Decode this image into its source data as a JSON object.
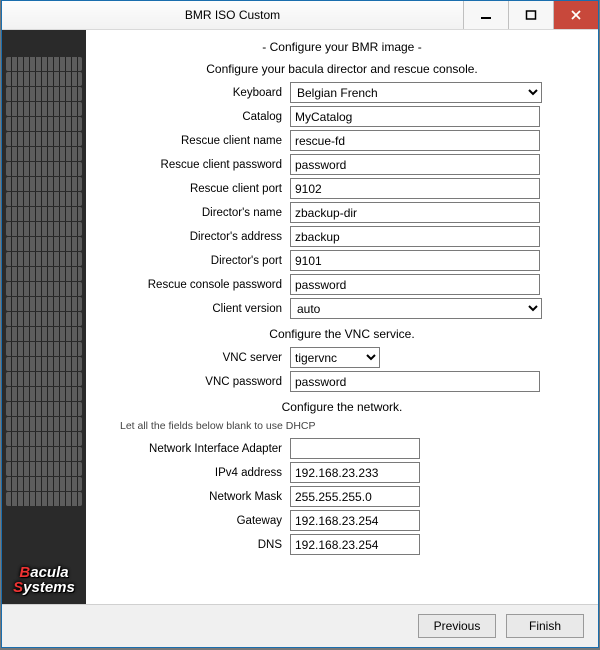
{
  "window": {
    "title": "BMR ISO Custom"
  },
  "headings": {
    "main": "- Configure your BMR image -",
    "section_director": "Configure your bacula director and rescue console.",
    "section_vnc": "Configure the VNC service.",
    "section_network": "Configure the network.",
    "network_hint": "Let all the fields below blank to use DHCP"
  },
  "labels": {
    "keyboard": "Keyboard",
    "catalog": "Catalog",
    "rescue_client_name": "Rescue client name",
    "rescue_client_password": "Rescue client password",
    "rescue_client_port": "Rescue client port",
    "director_name": "Director's name",
    "director_address": "Director's address",
    "director_port": "Director's port",
    "rescue_console_password": "Rescue console password",
    "client_version": "Client version",
    "vnc_server": "VNC server",
    "vnc_password": "VNC password",
    "nic": "Network Interface Adapter",
    "ipv4": "IPv4 address",
    "netmask": "Network Mask",
    "gateway": "Gateway",
    "dns": "DNS"
  },
  "values": {
    "keyboard": "Belgian French",
    "catalog": "MyCatalog",
    "rescue_client_name": "rescue-fd",
    "rescue_client_password": "password",
    "rescue_client_port": "9102",
    "director_name": "zbackup-dir",
    "director_address": "zbackup",
    "director_port": "9101",
    "rescue_console_password": "password",
    "client_version": "auto",
    "vnc_server": "tigervnc",
    "vnc_password": "password",
    "nic": "",
    "ipv4": "192.168.23.233",
    "netmask": "255.255.255.0",
    "gateway": "192.168.23.254",
    "dns": "192.168.23.254"
  },
  "buttons": {
    "previous": "Previous",
    "finish": "Finish"
  },
  "logo": {
    "line1_a": "B",
    "line1_b": "acula",
    "line2_a": "S",
    "line2_b": "ystems"
  }
}
